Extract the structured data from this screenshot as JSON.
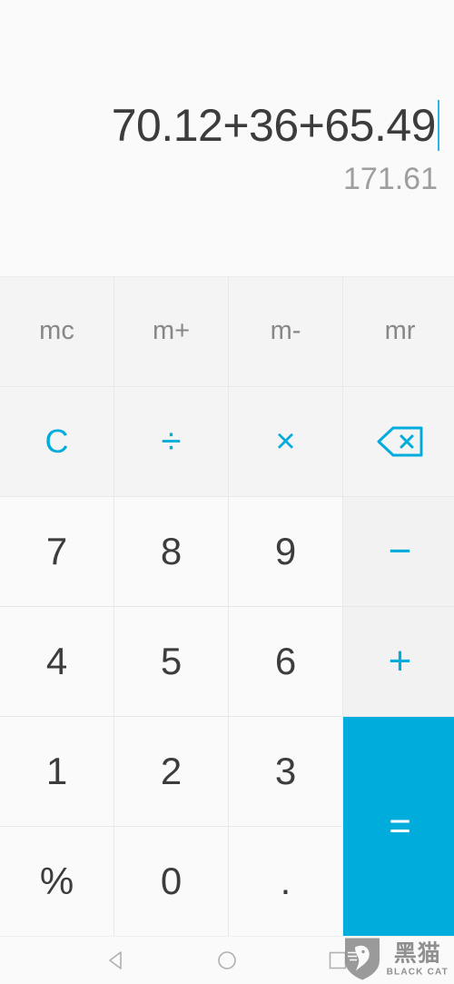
{
  "display": {
    "expression": "70.12+36+65.49",
    "result": "171.61",
    "caret_color": "#29b6e8",
    "expression_color": "#3c3c3c",
    "result_color": "#9e9e9e"
  },
  "theme": {
    "accent": "#00acdc",
    "key_bg": "#fafafa",
    "func_bg": "#f4f4f4",
    "op_bg": "#f2f2f2",
    "divider": "#e8e8e8"
  },
  "keypad": {
    "memory_row": [
      {
        "label": "mc",
        "name": "memory-clear"
      },
      {
        "label": "m+",
        "name": "memory-add"
      },
      {
        "label": "m-",
        "name": "memory-subtract"
      },
      {
        "label": "mr",
        "name": "memory-recall"
      }
    ],
    "function_row": [
      {
        "label": "C",
        "name": "clear"
      },
      {
        "label": "÷",
        "name": "divide"
      },
      {
        "label": "×",
        "name": "multiply"
      },
      {
        "label": "backspace-icon",
        "name": "backspace"
      }
    ],
    "row_789": [
      {
        "label": "7",
        "name": "digit-7"
      },
      {
        "label": "8",
        "name": "digit-8"
      },
      {
        "label": "9",
        "name": "digit-9"
      },
      {
        "label": "−",
        "name": "subtract"
      }
    ],
    "row_456": [
      {
        "label": "4",
        "name": "digit-4"
      },
      {
        "label": "5",
        "name": "digit-5"
      },
      {
        "label": "6",
        "name": "digit-6"
      },
      {
        "label": "+",
        "name": "add"
      }
    ],
    "row_123": [
      {
        "label": "1",
        "name": "digit-1"
      },
      {
        "label": "2",
        "name": "digit-2"
      },
      {
        "label": "3",
        "name": "digit-3"
      }
    ],
    "row_last": [
      {
        "label": "%",
        "name": "percent"
      },
      {
        "label": "0",
        "name": "digit-0"
      },
      {
        "label": ".",
        "name": "decimal-point"
      }
    ],
    "equals": {
      "label": "=",
      "name": "equals"
    }
  },
  "navbar": {
    "back": "back-icon",
    "home": "home-icon",
    "recents": "recents-icon"
  },
  "watermark": {
    "cn": "黑猫",
    "en": "BLACK CAT"
  }
}
